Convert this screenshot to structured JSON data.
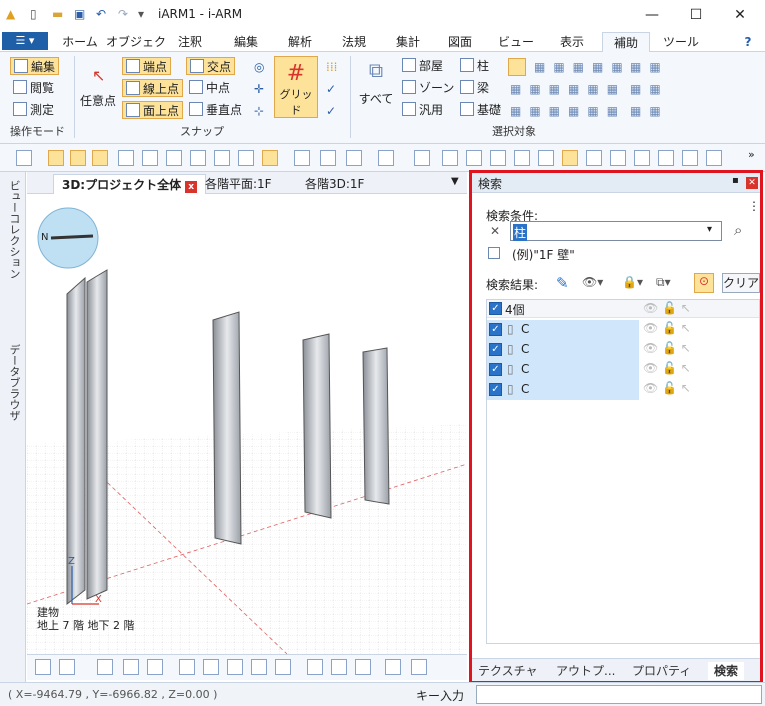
{
  "window": {
    "title": "iARM1 - i-ARM",
    "minimize": "—",
    "maximize": "☐",
    "close": "✕"
  },
  "ribbon_tabs": [
    "ホーム",
    "オブジェク",
    "注釈",
    "編集",
    "解析",
    "法規",
    "集計",
    "図面",
    "ビュー",
    "表示",
    "補助",
    "ツール"
  ],
  "file_button": "☰ ▾",
  "help_icon": "?",
  "ribbon": {
    "mode": {
      "edit": "編集",
      "browse": "閲覧",
      "measure": "測定",
      "label": "操作モード"
    },
    "snap": {
      "arbitrary": "任意点",
      "endpoint": "端点",
      "on_line": "線上点",
      "on_face": "面上点",
      "intersection": "交点",
      "midpoint": "中点",
      "perpendicular": "垂直点",
      "grid": "グリッド",
      "label": "スナップ"
    },
    "select": {
      "all": "すべて",
      "room": "部屋",
      "zone": "ゾーン",
      "generic": "汎用",
      "column": "柱",
      "beam": "梁",
      "foundation": "基礎",
      "label": "選択対象"
    }
  },
  "left_tabs": [
    "ビューコレクション",
    "データブラウザ"
  ],
  "doc_tabs": [
    {
      "label": "3D:プロジェクト全体",
      "active": true
    },
    {
      "label": "各階平面:1F"
    },
    {
      "label": "各階3D:1F"
    }
  ],
  "doc_tab_dropdown": "▼",
  "viewport": {
    "compass_north": "N",
    "axis_z": "Z",
    "axis_x": "X",
    "building_label": "建物",
    "floors_label": "地上 7 階  地下 2 階"
  },
  "status": {
    "coords": "( X=-9464.79 , Y=-6966.82 , Z=0.00 )",
    "key_input_label": "キー入力"
  },
  "search_panel": {
    "title": "検索",
    "pin_icon": "▪",
    "close_icon": "✕",
    "more_icon": "⋮",
    "criteria_label": "検索条件:",
    "query_value": "柱",
    "clear_query": "✕",
    "search_icon": "⌕",
    "example": "(例)\"1F 壁\"",
    "results_label": "検索結果:",
    "clear_button": "クリア",
    "summary": "4個",
    "results": [
      {
        "name": "C"
      },
      {
        "name": "C"
      },
      {
        "name": "C"
      },
      {
        "name": "C"
      }
    ]
  },
  "panel_tabs": [
    {
      "label": "テクスチャ"
    },
    {
      "label": "アウトプ..."
    },
    {
      "label": "プロパティ"
    },
    {
      "label": "検索",
      "active": true
    }
  ],
  "colors": {
    "accent": "#2a73c8",
    "highlight": "#fde29a",
    "red_frame": "#e0141e"
  }
}
